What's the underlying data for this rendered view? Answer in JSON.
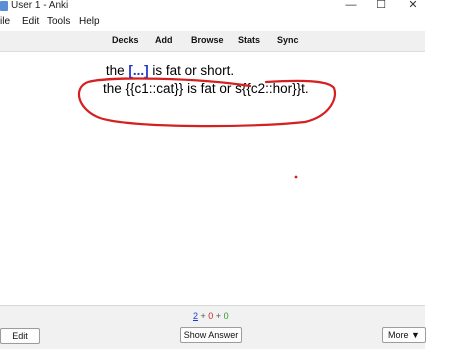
{
  "window": {
    "title": "User 1 - Anki",
    "minimize": "—",
    "maximize": "☐",
    "close": "✕"
  },
  "menu": {
    "items": [
      "ile",
      "Edit",
      "Tools",
      "Help"
    ]
  },
  "toolbar": {
    "items": [
      "Decks",
      "Add",
      "Browse",
      "Stats",
      "Sync"
    ]
  },
  "card": {
    "question_prefix": "the ",
    "question_cloze": "[...]",
    "question_suffix": " is fat or short.",
    "answer_text": "the {{c1::cat}} is fat or s{{c2::hor}}t."
  },
  "counts": {
    "new": "2",
    "sep1": " + ",
    "learn": "0",
    "sep2": " + ",
    "review": "0"
  },
  "buttons": {
    "edit": "Edit",
    "show_answer": "Show Answer",
    "more": "More ▼"
  },
  "colors": {
    "cloze": "#1d35c7",
    "annotation": "#d42020",
    "new": "#1a3ad3",
    "learn": "#c8282a",
    "review": "#2c9a2c"
  }
}
